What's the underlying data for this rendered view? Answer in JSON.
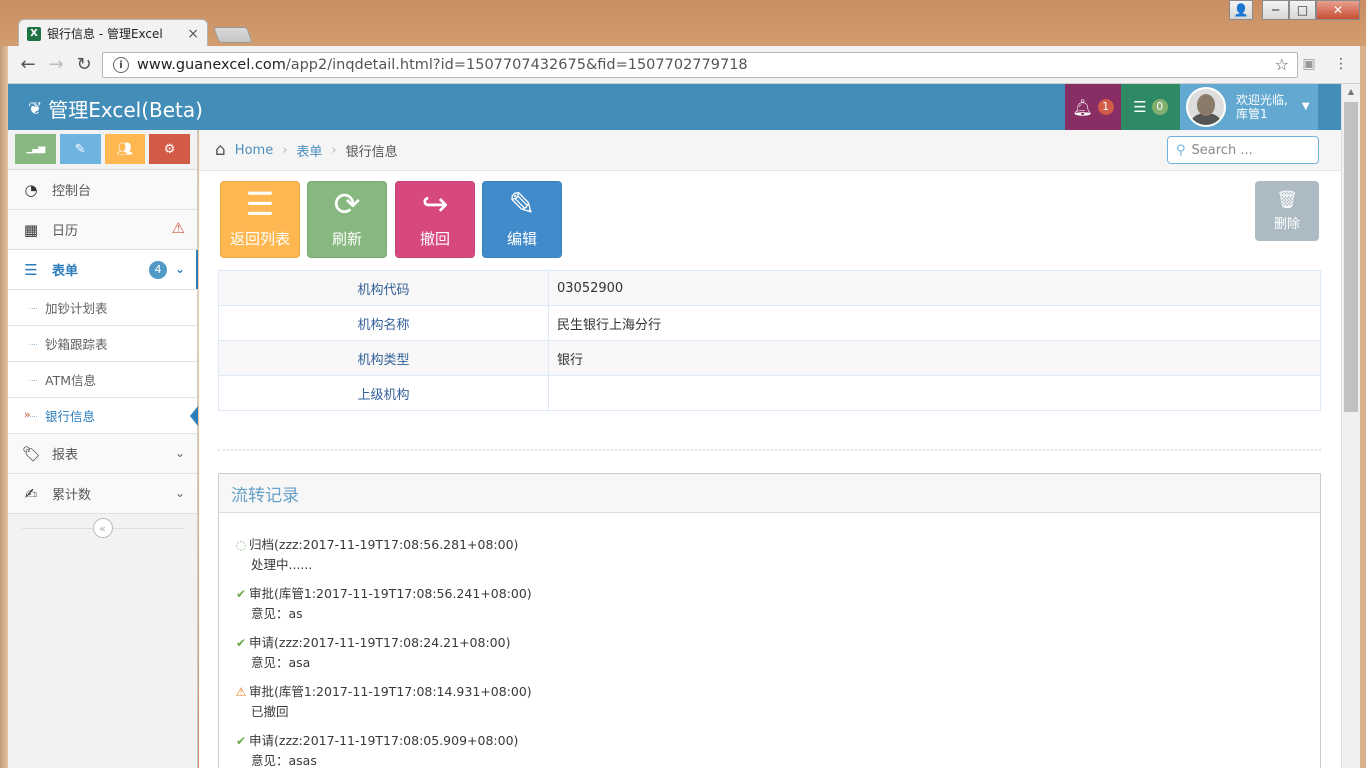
{
  "browser": {
    "tab_title": "银行信息 - 管理Excel",
    "url_host": "www.guanexcel.com",
    "url_path": "/app2/inqdetail.html?id=1507707432675&fid=1507702779718",
    "window_controls": [
      "─",
      "□",
      "✕"
    ]
  },
  "navbar": {
    "brand": "管理Excel(Beta)",
    "notifications_count": "1",
    "tasks_count": "0",
    "welcome": "欢迎光临,",
    "username": "库管1",
    "colors": {
      "bar": "#438eb9",
      "notif": "#892e65",
      "tasks": "#2e8965",
      "user": "#62a8d1"
    }
  },
  "sidebar": {
    "shortcuts": [
      {
        "name": "stats-icon",
        "color": "#87b87f",
        "glyph": "▁▃▅"
      },
      {
        "name": "pencil-icon",
        "color": "#6fb3e0",
        "glyph": "✎"
      },
      {
        "name": "users-icon",
        "color": "#ffb752",
        "glyph": "👥"
      },
      {
        "name": "cogs-icon",
        "color": "#d15b47",
        "glyph": "⚙"
      }
    ],
    "items": [
      {
        "label": "控制台",
        "icon": "tachometer-icon"
      },
      {
        "label": "日历",
        "icon": "calendar-icon",
        "alert": "⚠"
      },
      {
        "label": "表单",
        "icon": "list-icon",
        "badge": "4"
      },
      {
        "label": "报表",
        "icon": "tag-icon"
      },
      {
        "label": "累计数",
        "icon": "edit-icon"
      }
    ],
    "submenu": [
      "加钞计划表",
      "钞箱跟踪表",
      "ATM信息",
      "银行信息"
    ]
  },
  "breadcrumb": {
    "home": "Home",
    "section": "表单",
    "current": "银行信息"
  },
  "search": {
    "placeholder": "Search ..."
  },
  "actions": {
    "back": "返回列表",
    "refresh": "刷新",
    "revoke": "撤回",
    "edit": "编辑",
    "delete": "删除"
  },
  "details": [
    {
      "label": "机构代码",
      "value": "03052900"
    },
    {
      "label": "机构名称",
      "value": "民生银行上海分行"
    },
    {
      "label": "机构类型",
      "value": "银行"
    },
    {
      "label": "上级机构",
      "value": ""
    }
  ],
  "flow": {
    "title": "流转记录",
    "entries": [
      {
        "status": "processing",
        "text": "归档(zzz:2017-11-19T17:08:56.281+08:00)",
        "note": "处理中......"
      },
      {
        "status": "ok",
        "text": "审批(库管1:2017-11-19T17:08:56.241+08:00)",
        "note": "意见：as"
      },
      {
        "status": "ok",
        "text": "申请(zzz:2017-11-19T17:08:24.21+08:00)",
        "note": "意见：asa"
      },
      {
        "status": "warning",
        "text": "审批(库管1:2017-11-19T17:08:14.931+08:00)",
        "note": "已撤回"
      },
      {
        "status": "ok",
        "text": "申请(zzz:2017-11-19T17:08:05.909+08:00)",
        "note": "意见：asas"
      }
    ]
  }
}
